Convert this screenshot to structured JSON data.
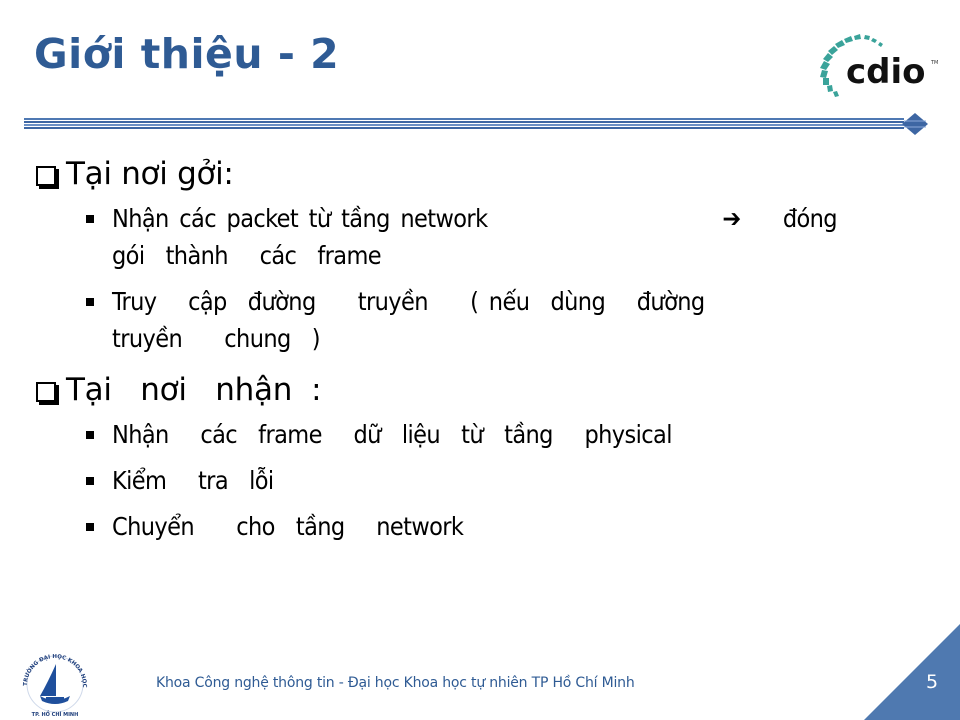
{
  "slide": {
    "title": "Giới thiệu - 2",
    "logo_text": "cdio",
    "logo_tm": "TM",
    "accent_color": "#2f5b94",
    "sections": [
      {
        "heading": "Tại nơi gởi:",
        "items": [
          {
            "line1_left": "Nhận các packet từ tầng network",
            "arrow": "➔",
            "line1_right": "đóng",
            "line2": "gói  thành   các  frame"
          },
          {
            "line1": "Truy   cập  đường    truyền    ( nếu  dùng   đường",
            "line2": "truyền    chung  )"
          }
        ]
      },
      {
        "heading": "Tại   nơi   nhận  :",
        "items": [
          {
            "line1": "Nhận   các  frame   dữ  liệu  từ  tầng   physical"
          },
          {
            "line1": "Kiểm   tra  lỗi"
          },
          {
            "line1": "Chuyển    cho  tầng   network"
          }
        ]
      }
    ]
  },
  "footer": {
    "text": "Khoa Công nghệ thông tin - Đại học Khoa học tự nhiên TP Hồ Chí Minh",
    "university_logo_top": "TRƯỜNG ĐẠI HỌC KHOA HỌC TỰ NHIÊN",
    "university_logo_bottom": "TP. HỒ CHÍ MINH",
    "page_number": "5"
  }
}
